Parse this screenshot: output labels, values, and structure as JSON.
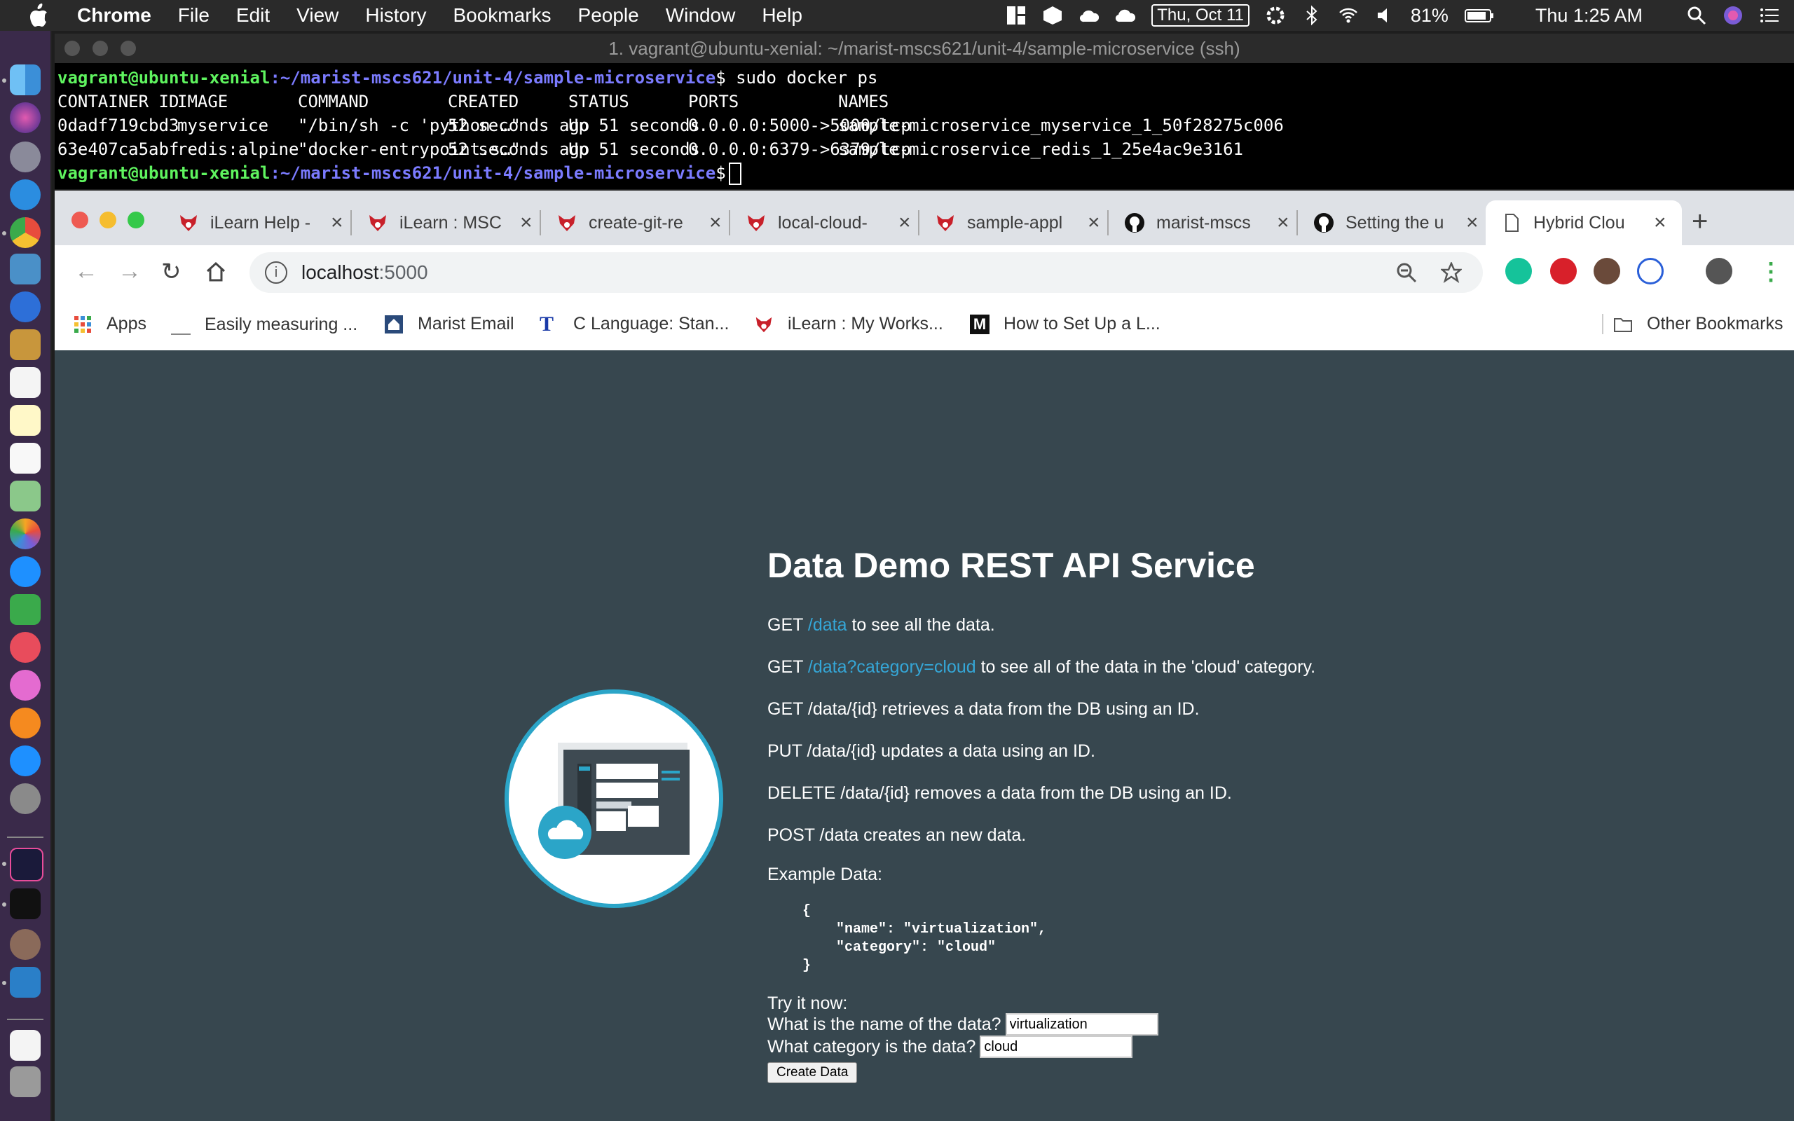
{
  "menubar": {
    "app": "Chrome",
    "items": [
      "File",
      "Edit",
      "View",
      "History",
      "Bookmarks",
      "People",
      "Window",
      "Help"
    ],
    "date": "Thu, Oct 11",
    "battery": "81%",
    "clock": "Thu 1:25 AM"
  },
  "terminal": {
    "title": "1. vagrant@ubuntu-xenial: ~/marist-mscs621/unit-4/sample-microservice (ssh)",
    "prompt_user": "vagrant@ubuntu-xenial",
    "prompt_path": ":~/marist-mscs621/unit-4/sample-microservice",
    "prompt_symbol": "$",
    "command": " sudo docker ps",
    "headers": [
      "CONTAINER ID",
      "IMAGE",
      "COMMAND",
      "CREATED",
      "STATUS",
      "PORTS",
      "NAMES"
    ],
    "rows": [
      [
        "0dadf719cbd3",
        "myservice",
        "\"/bin/sh -c 'python …\"",
        "52 seconds ago",
        "Up 51 seconds",
        "0.0.0.0:5000->5000/tcp",
        "sample-microservice_myservice_1_50f28275c006"
      ],
      [
        "63e407ca5abf",
        "redis:alpine",
        "\"docker-entrypoint.s…\"",
        "52 seconds ago",
        "Up 51 seconds",
        "0.0.0.0:6379->6379/tcp",
        "sample-microservice_redis_1_25e4ac9e3161"
      ]
    ]
  },
  "browser": {
    "tabs": [
      {
        "label": "iLearn Help -",
        "icon": "red-fox-icon"
      },
      {
        "label": "iLearn : MSC",
        "icon": "red-fox-icon"
      },
      {
        "label": "create-git-re",
        "icon": "red-fox-icon"
      },
      {
        "label": "local-cloud-",
        "icon": "red-fox-icon"
      },
      {
        "label": "sample-appl",
        "icon": "red-fox-icon"
      },
      {
        "label": "marist-mscs",
        "icon": "github-icon"
      },
      {
        "label": "Setting the u",
        "icon": "github-icon"
      },
      {
        "label": "Hybrid Clou",
        "icon": "page-icon"
      }
    ],
    "url_host": "localhost",
    "url_port": ":5000",
    "bookmarks": [
      "Apps",
      "Easily measuring ...",
      "Marist Email",
      "C Language: Stan...",
      "iLearn : My Works...",
      "How to Set Up a L..."
    ],
    "other_bookmarks": "Other Bookmarks"
  },
  "page": {
    "title": "Data Demo REST API Service",
    "lines": [
      {
        "prefix": "GET ",
        "link": "/data",
        "suffix": " to see all the data."
      },
      {
        "prefix": "GET ",
        "link": "/data?category=cloud",
        "suffix": " to see all of the data in the 'cloud' category."
      }
    ],
    "plain_lines": [
      "GET /data/{id} retrieves a data from the DB using an ID.",
      "PUT /data/{id} updates a data using an ID.",
      "DELETE /data/{id} removes a data from the DB using an ID.",
      "POST /data creates an new data."
    ],
    "example_label": "Example Data:",
    "example_code": "{\n    \"name\": \"virtualization\",\n    \"category\": \"cloud\"\n}",
    "try_label": "Try it now:",
    "name_question": "What is the name of the data?",
    "name_value": "virtualization",
    "category_question": "What category is the data?",
    "category_value": "cloud",
    "button_label": "Create Data"
  },
  "colors": {
    "page_bg": "#37474f",
    "link": "#35a6d6",
    "circle_border": "#2ba5c8"
  }
}
